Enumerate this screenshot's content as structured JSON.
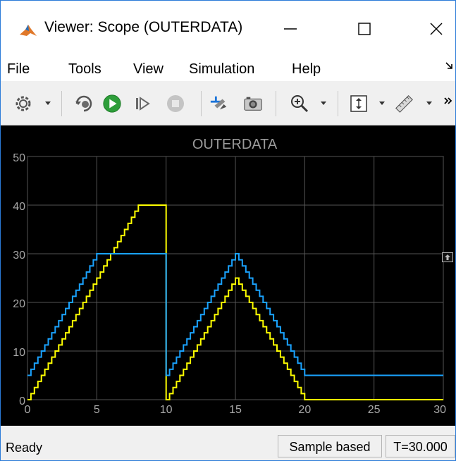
{
  "window": {
    "title": "Viewer: Scope (OUTERDATA)"
  },
  "menu": {
    "items": [
      "File",
      "Tools",
      "View",
      "Simulation",
      "Help"
    ]
  },
  "toolbar": {
    "icons": [
      "gear-icon",
      "step-back-icon",
      "run-icon",
      "step-forward-icon",
      "stop-icon",
      "highlight-signal-icon",
      "snapshot-icon",
      "zoom-in-icon",
      "autoscale-icon",
      "measurements-icon"
    ]
  },
  "status": {
    "ready": "Ready",
    "sample": "Sample based",
    "time": "T=30.000"
  },
  "chart_data": {
    "type": "line",
    "title": "OUTERDATA",
    "xlabel": "",
    "ylabel": "",
    "xlim": [
      0,
      30
    ],
    "ylim": [
      0,
      50
    ],
    "xticks": [
      0,
      5,
      10,
      15,
      20,
      25,
      30
    ],
    "yticks": [
      0,
      10,
      20,
      30,
      40,
      50
    ],
    "grid": true,
    "series": [
      {
        "color": "#ffff00",
        "points": [
          [
            0,
            0
          ],
          [
            8,
            40
          ],
          [
            10,
            40
          ],
          [
            10,
            0
          ],
          [
            15,
            25
          ],
          [
            20,
            0
          ],
          [
            30,
            0
          ]
        ]
      },
      {
        "color": "#1aa3ff",
        "points": [
          [
            0,
            5
          ],
          [
            5,
            30
          ],
          [
            10,
            30
          ],
          [
            10,
            5
          ],
          [
            15,
            30
          ],
          [
            20,
            5
          ],
          [
            30,
            5
          ]
        ]
      }
    ]
  }
}
